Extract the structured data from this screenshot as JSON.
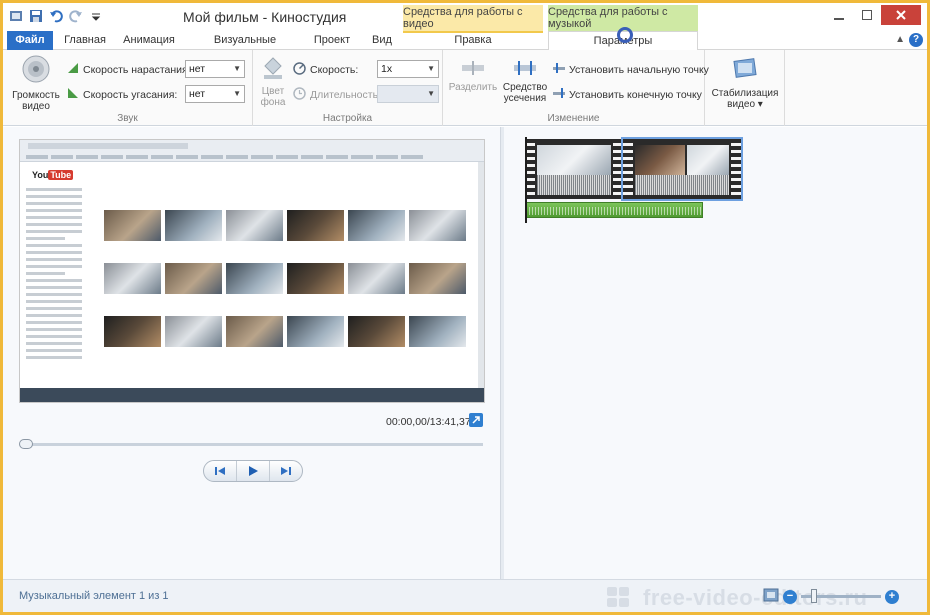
{
  "window": {
    "title": "Мой фильм - Киностудия",
    "contextual": {
      "video_tools": "Средства для работы с видео",
      "music_tools": "Средства для работы с музыкой"
    }
  },
  "tabs": {
    "file": "Файл",
    "home": "Главная",
    "animation": "Анимация",
    "visual_effects": "Визуальные эффекты",
    "project": "Проект",
    "view": "Вид",
    "edit": "Правка",
    "options": "Параметры",
    "active": "Параметры"
  },
  "ribbon": {
    "sound": {
      "label": "Звук",
      "video_volume_line1": "Громкость",
      "video_volume_line2": "видео",
      "fade_in_label": "Скорость нарастания:",
      "fade_in_value": "нет",
      "fade_out_label": "Скорость угасания:",
      "fade_out_value": "нет"
    },
    "adjust": {
      "label": "Настройка",
      "bg_color_line1": "Цвет",
      "bg_color_line2": "фона",
      "speed_label": "Скорость:",
      "speed_value": "1x",
      "duration_label": "Длительность:"
    },
    "editing": {
      "label": "Изменение",
      "split": "Разделить",
      "trim_line1": "Средство",
      "trim_line2": "усечения",
      "set_start": "Установить начальную точку",
      "set_end": "Установить конечную точку"
    },
    "stabilization": {
      "line1": "Стабилизация",
      "line2": "видео"
    }
  },
  "preview": {
    "site_name": "You",
    "site_name_box": "Tube",
    "timecode": "00:00,00/13:41,37",
    "seek_position": 0
  },
  "status": {
    "text": "Музыкальный элемент 1 из 1",
    "watermark": "free-video-editors.ru"
  },
  "colors": {
    "file_tab": "#2a6fc7",
    "video_context": "#fbe9a8",
    "music_context": "#cfe9a4",
    "music_bar": "#5fae3f"
  }
}
